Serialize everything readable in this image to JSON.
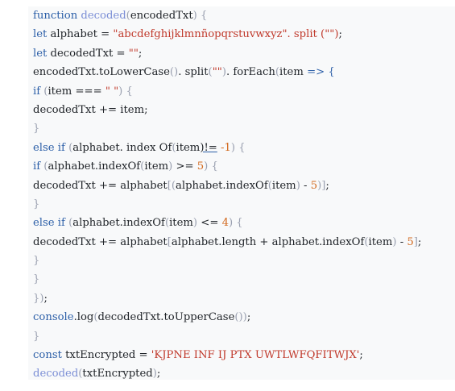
{
  "code": {
    "lines": [
      [
        {
          "t": "function ",
          "c": "kw"
        },
        {
          "t": "decoded",
          "c": "fn"
        },
        {
          "t": "(",
          "c": "br"
        },
        {
          "t": "encodedTxt",
          "c": "op"
        },
        {
          "t": ") {",
          "c": "br"
        }
      ],
      [
        {
          "t": "let ",
          "c": "kw"
        },
        {
          "t": "alphabet = ",
          "c": "op"
        },
        {
          "t": "\"abcdefghijklmnñopqrstuvwxyz\". split (\"\")",
          "c": "str"
        },
        {
          "t": ";",
          "c": "op"
        }
      ],
      [
        {
          "t": "let ",
          "c": "kw"
        },
        {
          "t": "decodedTxt = ",
          "c": "op"
        },
        {
          "t": "\"\"",
          "c": "str"
        },
        {
          "t": ";",
          "c": "op"
        }
      ],
      [
        {
          "t": "encodedTxt.toLowerCase",
          "c": "op"
        },
        {
          "t": "()",
          "c": "br"
        },
        {
          "t": ". split",
          "c": "op"
        },
        {
          "t": "(",
          "c": "br"
        },
        {
          "t": "\"\"",
          "c": "str"
        },
        {
          "t": ")",
          "c": "br"
        },
        {
          "t": ". forEach",
          "c": "op"
        },
        {
          "t": "(",
          "c": "br"
        },
        {
          "t": "item ",
          "c": "op"
        },
        {
          "t": "=> {",
          "c": "kw"
        }
      ],
      [
        {
          "t": "if ",
          "c": "kw"
        },
        {
          "t": "(",
          "c": "br"
        },
        {
          "t": "item === ",
          "c": "op"
        },
        {
          "t": "\" \"",
          "c": "str"
        },
        {
          "t": ") {",
          "c": "br"
        }
      ],
      [
        {
          "t": "decodedTxt += item;",
          "c": "op"
        }
      ],
      [
        {
          "t": "}",
          "c": "br"
        }
      ],
      [
        {
          "t": "else if ",
          "c": "kw"
        },
        {
          "t": "(",
          "c": "br"
        },
        {
          "t": "alphabet. index Of",
          "c": "op"
        },
        {
          "t": "(",
          "c": "br"
        },
        {
          "t": "item",
          "c": "op"
        },
        {
          "t": ")!=",
          "c": "under"
        },
        {
          "t": " -1",
          "c": "num"
        },
        {
          "t": ") {",
          "c": "br"
        }
      ],
      [
        {
          "t": "if ",
          "c": "kw"
        },
        {
          "t": "(",
          "c": "br"
        },
        {
          "t": "alphabet.indexOf",
          "c": "op"
        },
        {
          "t": "(",
          "c": "br"
        },
        {
          "t": "item",
          "c": "op"
        },
        {
          "t": ")",
          "c": "br"
        },
        {
          "t": " >= ",
          "c": "op"
        },
        {
          "t": "5",
          "c": "num"
        },
        {
          "t": ") {",
          "c": "br"
        }
      ],
      [
        {
          "t": "decodedTxt += alphabet",
          "c": "op"
        },
        {
          "t": "[(",
          "c": "br"
        },
        {
          "t": "alphabet.indexOf",
          "c": "op"
        },
        {
          "t": "(",
          "c": "br"
        },
        {
          "t": "item",
          "c": "op"
        },
        {
          "t": ")",
          "c": "br"
        },
        {
          "t": " - ",
          "c": "op"
        },
        {
          "t": "5",
          "c": "num"
        },
        {
          "t": ")]",
          "c": "br"
        },
        {
          "t": ";",
          "c": "op"
        }
      ],
      [
        {
          "t": "}",
          "c": "br"
        }
      ],
      [
        {
          "t": "else if ",
          "c": "kw"
        },
        {
          "t": "(",
          "c": "br"
        },
        {
          "t": "alphabet.indexOf",
          "c": "op"
        },
        {
          "t": "(",
          "c": "br"
        },
        {
          "t": "item",
          "c": "op"
        },
        {
          "t": ")",
          "c": "br"
        },
        {
          "t": " <= ",
          "c": "op"
        },
        {
          "t": "4",
          "c": "num"
        },
        {
          "t": ") {",
          "c": "br"
        }
      ],
      [
        {
          "t": "decodedTxt += alphabet",
          "c": "op"
        },
        {
          "t": "[",
          "c": "br"
        },
        {
          "t": "alphabet.length + alphabet.indexOf",
          "c": "op"
        },
        {
          "t": "(",
          "c": "br"
        },
        {
          "t": "item",
          "c": "op"
        },
        {
          "t": ")",
          "c": "br"
        },
        {
          "t": " - ",
          "c": "op"
        },
        {
          "t": "5",
          "c": "num"
        },
        {
          "t": "]",
          "c": "br"
        },
        {
          "t": ";",
          "c": "op"
        }
      ],
      [
        {
          "t": "}",
          "c": "br"
        }
      ],
      [
        {
          "t": "}",
          "c": "br"
        }
      ],
      [
        {
          "t": "})",
          "c": "br"
        },
        {
          "t": ";",
          "c": "op"
        }
      ],
      [
        {
          "t": "console",
          "c": "kw"
        },
        {
          "t": ".log",
          "c": "op"
        },
        {
          "t": "(",
          "c": "br"
        },
        {
          "t": "decodedTxt.toUpperCase",
          "c": "op"
        },
        {
          "t": "())",
          "c": "br"
        },
        {
          "t": ";",
          "c": "op"
        }
      ],
      [
        {
          "t": "}",
          "c": "br"
        }
      ],
      [
        {
          "t": "const ",
          "c": "kw"
        },
        {
          "t": "txtEncrypted = ",
          "c": "op"
        },
        {
          "t": "'KJPNE INF IJ PTX UWTLWFQFITWJX'",
          "c": "str"
        },
        {
          "t": ";",
          "c": "op"
        }
      ],
      [
        {
          "t": "decoded",
          "c": "fn"
        },
        {
          "t": "(",
          "c": "br"
        },
        {
          "t": "txtEncrypted",
          "c": "op"
        },
        {
          "t": ")",
          "c": "br"
        },
        {
          "t": ";",
          "c": "op"
        }
      ]
    ]
  }
}
